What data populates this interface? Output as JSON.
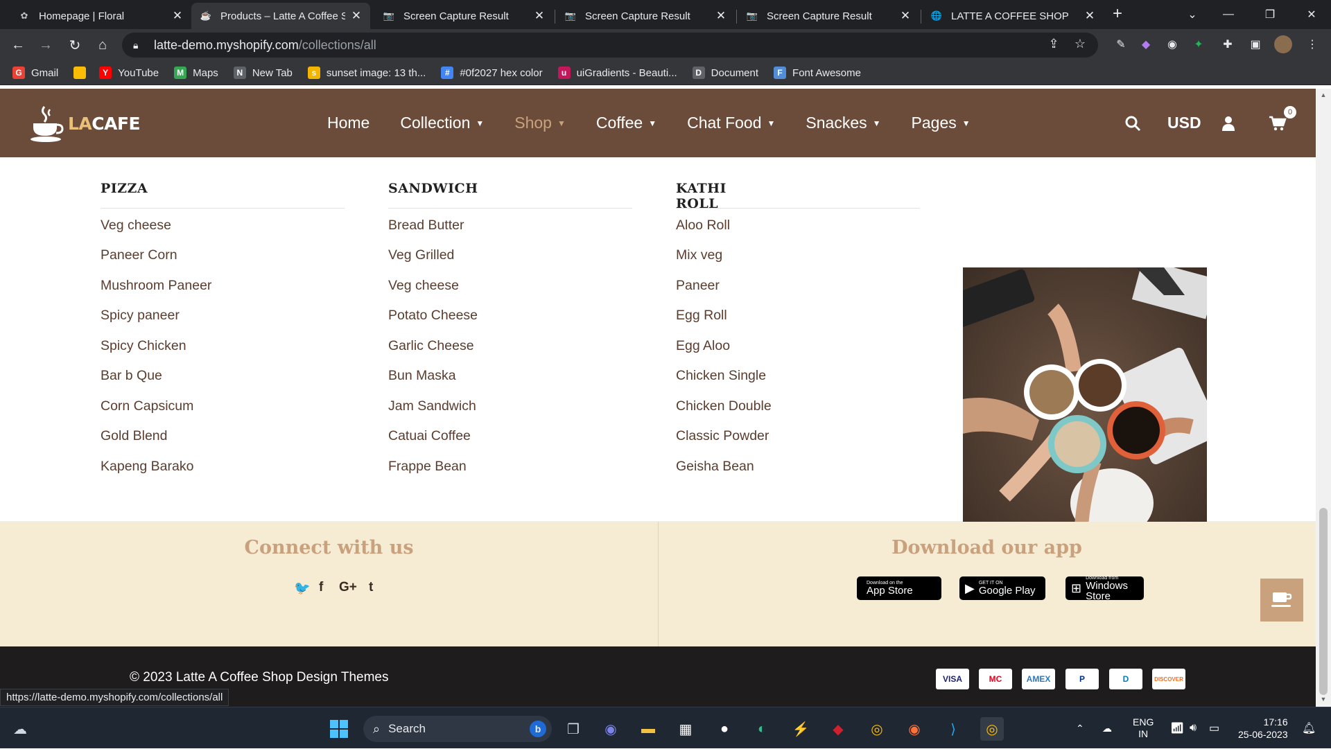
{
  "browser": {
    "tabs": [
      {
        "title": "Homepage | Floral",
        "active": false
      },
      {
        "title": "Products – Latte A Coffee S",
        "active": true
      },
      {
        "title": "Screen Capture Result",
        "active": false
      },
      {
        "title": "Screen Capture Result",
        "active": false
      },
      {
        "title": "Screen Capture Result",
        "active": false
      },
      {
        "title": "LATTE A COFFEE SHOP",
        "active": false
      }
    ],
    "url_host": "latte-demo.myshopify.com",
    "url_path": "/collections/all",
    "bookmarks": [
      {
        "label": "Gmail",
        "icon": "gmail-icon",
        "color": "#ea4335"
      },
      {
        "label": "",
        "icon": "chrome-colorful-icon",
        "color": "#fbbc05"
      },
      {
        "label": "YouTube",
        "icon": "youtube-icon",
        "color": "#ff0000"
      },
      {
        "label": "Maps",
        "icon": "maps-pin-icon",
        "color": "#34a853"
      },
      {
        "label": "New Tab",
        "icon": "globe-icon",
        "color": "#5f6368"
      },
      {
        "label": "sunset image: 13 th...",
        "icon": "image-icon",
        "color": "#f5b400"
      },
      {
        "label": "#0f2027 hex color",
        "icon": "color-c-icon",
        "color": "#4285f4"
      },
      {
        "label": "uiGradients - Beauti...",
        "icon": "gradient-icon",
        "color": "#c2185b"
      },
      {
        "label": "Document",
        "icon": "globe-icon",
        "color": "#5f6368"
      },
      {
        "label": "Font Awesome",
        "icon": "flag-icon",
        "color": "#528dd7"
      }
    ]
  },
  "site": {
    "logo": {
      "la": "LA",
      "cafe": "CAFE"
    },
    "nav": [
      {
        "label": "Home",
        "dropdown": false,
        "active": false
      },
      {
        "label": "Collection",
        "dropdown": true,
        "active": false
      },
      {
        "label": "Shop",
        "dropdown": true,
        "active": true
      },
      {
        "label": "Coffee",
        "dropdown": true,
        "active": false
      },
      {
        "label": "Chat Food",
        "dropdown": true,
        "active": false
      },
      {
        "label": "Snackes",
        "dropdown": true,
        "active": false
      },
      {
        "label": "Pages",
        "dropdown": true,
        "active": false
      }
    ],
    "currency": "USD",
    "cart_count": "0",
    "colors": {
      "header": "#6b4c3b",
      "accent": "#c9a27d",
      "band": "#f6ecd4",
      "footer": "#1e1c1c",
      "link": "#5a3d2e"
    }
  },
  "mega_menu": {
    "columns": [
      {
        "heading": "PIZZA",
        "items": [
          "Veg cheese",
          "Paneer Corn",
          "Mushroom Paneer",
          "Spicy paneer",
          "Spicy Chicken",
          "Bar b Que",
          "Corn Capsicum",
          "Gold Blend",
          "Kapeng Barako"
        ]
      },
      {
        "heading": "SANDWICH",
        "items": [
          "Bread Butter",
          "Veg Grilled",
          "Veg cheese",
          "Potato Cheese",
          "Garlic Cheese",
          "Bun Maska",
          "Jam Sandwich",
          "Catuai Coffee",
          "Frappe Bean"
        ]
      },
      {
        "heading": "KATHI ROLL",
        "items": [
          "Aloo Roll",
          "Mix veg",
          "Paneer",
          "Egg Roll",
          "Egg Aloo",
          "Chicken Single",
          "Chicken Double",
          "Classic Powder",
          "Geisha Bean"
        ]
      }
    ]
  },
  "connect": {
    "title": "Connect with us",
    "social": [
      {
        "glyph": "🐦",
        "icon": "twitter-icon"
      },
      {
        "glyph": "f",
        "icon": "facebook-icon"
      },
      {
        "glyph": "G+",
        "icon": "google-plus-icon"
      },
      {
        "glyph": "t",
        "icon": "tumblr-icon"
      }
    ]
  },
  "download": {
    "title": "Download our app",
    "stores": [
      {
        "small": "Download on the",
        "big": "App Store",
        "icon": "apple-icon"
      },
      {
        "small": "GET IT ON",
        "big": "Google Play",
        "icon": "google-play-icon"
      },
      {
        "small": "Download from",
        "big": "Windows Store",
        "icon": "windows-icon"
      }
    ]
  },
  "footer": {
    "copyright": "© 2023 Latte A Coffee Shop Design Themes",
    "payments": [
      {
        "label": "VISA",
        "color": "#1a1f71"
      },
      {
        "label": "MC",
        "color": "#eb001b"
      },
      {
        "label": "AMEX",
        "color": "#2e77bc"
      },
      {
        "label": "P",
        "color": "#003087"
      },
      {
        "label": "D",
        "color": "#0079be"
      },
      {
        "label": "DISCOVER",
        "color": "#f76f20"
      }
    ]
  },
  "status_url": "https://latte-demo.myshopify.com/collections/all",
  "taskbar": {
    "search_label": "Search",
    "lang": "ENG",
    "region": "IN",
    "time": "17:16",
    "date": "25-06-2023"
  }
}
